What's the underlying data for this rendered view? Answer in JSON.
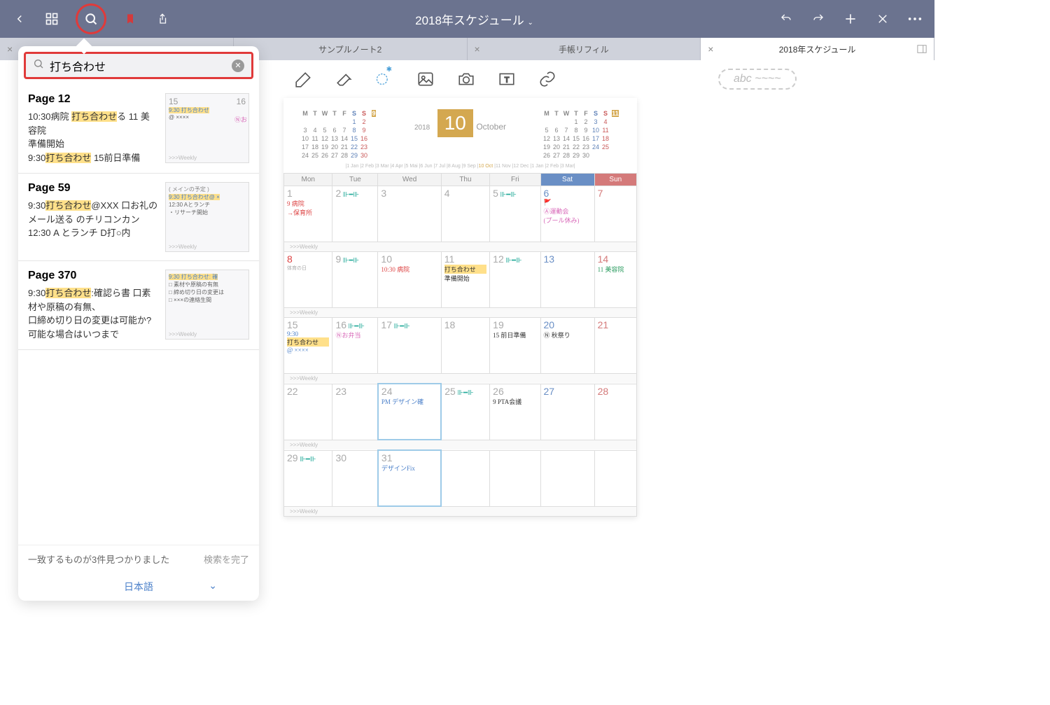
{
  "header": {
    "title": "2018年スケジュール"
  },
  "tabs": [
    {
      "label": "",
      "close": true
    },
    {
      "label": "サンプルノート2",
      "close": false
    },
    {
      "label": "手帳リフィル",
      "close": true
    },
    {
      "label": "2018年スケジュール",
      "close": true,
      "active": true
    }
  ],
  "handwriting_placeholder": "abc ~~~~",
  "search": {
    "query": "打ち合わせ",
    "results": [
      {
        "page": "Page 12",
        "snippet_parts": [
          {
            "t": "10:30病院 "
          },
          {
            "t": "打ち合わせ",
            "hl": true
          },
          {
            "t": "る 11 美容院\n準備開始\n9:30"
          },
          {
            "t": "打ち合わせ",
            "hl": true
          },
          {
            "t": " 15前日準備"
          }
        ],
        "thumb": {
          "left": "15",
          "right": "16",
          "lines": [
            "9:30 打ち合わせ",
            "@ ××××"
          ],
          "note_right": "Ⓝお"
        }
      },
      {
        "page": "Page 59",
        "snippet_parts": [
          {
            "t": "9:30"
          },
          {
            "t": "打ち合わせ",
            "hl": true
          },
          {
            "t": "@XXX 口お礼のメール送る のチリコンカン\n12:30 A とランチ D打○内"
          }
        ],
        "thumb": {
          "header": "( メインの予定 )",
          "lines": [
            "9:30 打ち合わせ@ ×",
            "12:30 Aとランチ",
            "・リサーチ開始"
          ]
        }
      },
      {
        "page": "Page 370",
        "snippet_parts": [
          {
            "t": "9:30"
          },
          {
            "t": "打ち合わせ",
            "hl": true
          },
          {
            "t": ":確認ら書 口素材や原稿の有無、\n口締め切り日の変更は可能か?可能な場合はいつまで"
          }
        ],
        "thumb": {
          "lines": [
            "9:30 打ち合わせ: 確",
            "□ 素材や原稿の有無",
            "□ 締め切り日の変更は",
            "□ ×××の連絡生間"
          ]
        }
      }
    ],
    "footer_match": "一致するものが3件見つかりました",
    "footer_done": "検索を完了",
    "language": "日本語"
  },
  "calendar": {
    "year": "2018",
    "month_num": "10",
    "month_name": "October",
    "header_days": [
      "Mon",
      "Tue",
      "Wed",
      "Thu",
      "Fri",
      "Sat",
      "Sun"
    ],
    "weekly_label": ">>>Weekly",
    "mini_left": {
      "badge": "9",
      "dow": [
        "M",
        "T",
        "W",
        "T",
        "F",
        "S",
        "S"
      ],
      "rows": [
        [
          "",
          "",
          "",
          "",
          "",
          "1",
          "2"
        ],
        [
          "3",
          "4",
          "5",
          "6",
          "7",
          "8",
          "9"
        ],
        [
          "10",
          "11",
          "12",
          "13",
          "14",
          "15",
          "16"
        ],
        [
          "17",
          "18",
          "19",
          "20",
          "21",
          "22",
          "23"
        ],
        [
          "24",
          "25",
          "26",
          "27",
          "28",
          "29",
          "30"
        ]
      ]
    },
    "mini_right": {
      "badge": "11",
      "dow": [
        "M",
        "T",
        "W",
        "T",
        "F",
        "S",
        "S"
      ],
      "rows": [
        [
          "",
          "",
          "",
          "1",
          "2",
          "3",
          "4"
        ],
        [
          "5",
          "6",
          "7",
          "8",
          "9",
          "10",
          "11"
        ],
        [
          "12",
          "13",
          "14",
          "15",
          "16",
          "17",
          "18"
        ],
        [
          "19",
          "20",
          "21",
          "22",
          "23",
          "24",
          "25"
        ],
        [
          "26",
          "27",
          "28",
          "29",
          "30",
          "",
          ""
        ]
      ]
    },
    "month_strip": "|1 Jan |2 Feb |3 Mar |4 Apr |5 Mai |6 Jun |7 Jul |8 Aug |9 Sep |10 Oct |11 Nov |12 Dec |1 Jan |2 Feb |3 Mar|",
    "cells": {
      "w1": [
        {
          "n": "1",
          "notes": [
            {
              "c": "hw-red",
              "t": "9 病院"
            },
            {
              "c": "hw-red",
              "t": "→保育所"
            }
          ]
        },
        {
          "n": "2",
          "db": true
        },
        {
          "n": "3"
        },
        {
          "n": "4"
        },
        {
          "n": "5",
          "db": true
        },
        {
          "n": "6",
          "sat": true,
          "notes": [
            {
              "c": "hw-pink",
              "t": "🚩"
            },
            {
              "c": "hw-pink",
              "t": "Ⓐ運動会"
            },
            {
              "c": "hw-pink",
              "t": "(プール休み)"
            }
          ]
        },
        {
          "n": "7",
          "sun": true
        }
      ],
      "w2": [
        {
          "n": "8",
          "red": true,
          "sub": "体育の日"
        },
        {
          "n": "9",
          "db": true
        },
        {
          "n": "10",
          "notes": [
            {
              "c": "hw-red",
              "t": "10:30 病院"
            }
          ]
        },
        {
          "n": "11",
          "notes": [
            {
              "c": "hw-black cell-hl",
              "t": "打ち合わせ"
            },
            {
              "c": "hw-black",
              "t": "準備開始"
            }
          ]
        },
        {
          "n": "12",
          "db": true
        },
        {
          "n": "13",
          "sat": true
        },
        {
          "n": "14",
          "sun": true,
          "notes": [
            {
              "c": "hw-green",
              "t": "11 美容院"
            }
          ]
        }
      ],
      "w3": [
        {
          "n": "15",
          "notes": [
            {
              "c": "hw-blue",
              "t": "9:30"
            },
            {
              "c": "hw-black cell-hl",
              "t": "打ち合わせ"
            },
            {
              "c": "hw-blue",
              "t": "@ ××××"
            }
          ]
        },
        {
          "n": "16",
          "db": true,
          "notes": [
            {
              "c": "hw-pink",
              "t": "Ⓝお弁当"
            }
          ]
        },
        {
          "n": "17",
          "db": true
        },
        {
          "n": "18"
        },
        {
          "n": "19",
          "notes": [
            {
              "c": "hw-black",
              "t": "15 前日準備"
            }
          ]
        },
        {
          "n": "20",
          "sat": true,
          "notes": [
            {
              "c": "hw-black",
              "t": "Ⓝ 秋祭り"
            }
          ]
        },
        {
          "n": "21",
          "sun": true
        }
      ],
      "w4": [
        {
          "n": "22"
        },
        {
          "n": "23"
        },
        {
          "n": "24",
          "today": true,
          "notes": [
            {
              "c": "hw-blue",
              "t": "PM デザイン確"
            }
          ]
        },
        {
          "n": "25",
          "db": true
        },
        {
          "n": "26",
          "notes": [
            {
              "c": "hw-black",
              "t": "9 PTA会議"
            }
          ]
        },
        {
          "n": "27",
          "sat": true
        },
        {
          "n": "28",
          "sun": true
        }
      ],
      "w5": [
        {
          "n": "29",
          "db": true
        },
        {
          "n": "30"
        },
        {
          "n": "31",
          "today": true,
          "notes": [
            {
              "c": "hw-blue",
              "t": "デザインFix"
            }
          ]
        },
        {
          "n": ""
        },
        {
          "n": ""
        },
        {
          "n": ""
        },
        {
          "n": ""
        }
      ]
    }
  }
}
